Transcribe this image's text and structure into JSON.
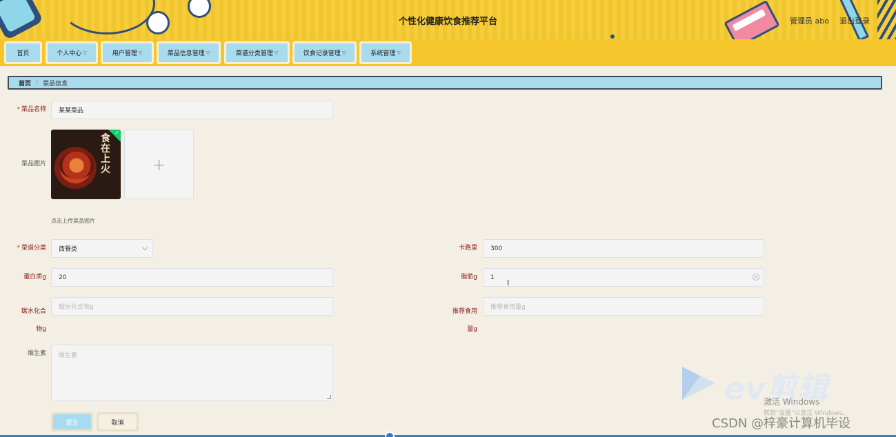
{
  "header": {
    "title": "个性化健康饮食推荐平台",
    "user": "管理员 abo",
    "logout": "退出登录"
  },
  "nav": [
    {
      "label": "首页"
    },
    {
      "label": "个人中心"
    },
    {
      "label": "用户管理"
    },
    {
      "label": "菜品信息管理"
    },
    {
      "label": "菜谱分类管理"
    },
    {
      "label": "饮食记录管理"
    },
    {
      "label": "系统管理"
    }
  ],
  "breadcrumb": {
    "home": "首页",
    "separator": "/",
    "current": "菜品信息"
  },
  "form": {
    "dish_name": {
      "label": "菜品名称",
      "value": "某某菜品"
    },
    "dish_image": {
      "label": "菜品图片",
      "hint": "点击上传菜品图片",
      "thumb_text": "食在上火"
    },
    "category": {
      "label": "菜谱分类",
      "value": "西餐类"
    },
    "calories": {
      "label": "卡路里",
      "value": "300"
    },
    "protein": {
      "label": "蛋白质g",
      "value": "20"
    },
    "fat": {
      "label": "脂肪g",
      "value": "1"
    },
    "carbs": {
      "label": "碳水化合物g",
      "label_line1": "碳水化合",
      "label_line2": "物g",
      "placeholder": "碳水化合物g"
    },
    "recommended_intake": {
      "label": "推荐食用量g",
      "label_line1": "推荐食用",
      "label_line2": "量g",
      "placeholder": "推荐食用量g"
    },
    "vitamin": {
      "label": "维生素",
      "placeholder": "维生素"
    },
    "submit": "提交",
    "cancel": "取消"
  },
  "watermarks": {
    "ev": "ev剪辑",
    "activate": "激活 Windows",
    "activate_hint": "转到\"设置\"以激活 Windows。",
    "csdn": "CSDN @梓豪计算机毕设"
  },
  "colors": {
    "header_yellow": "#f6cd3a",
    "nav_blue": "#a9dbee",
    "label_red": "#8b1a1a",
    "page_bg": "#f3efe4"
  }
}
